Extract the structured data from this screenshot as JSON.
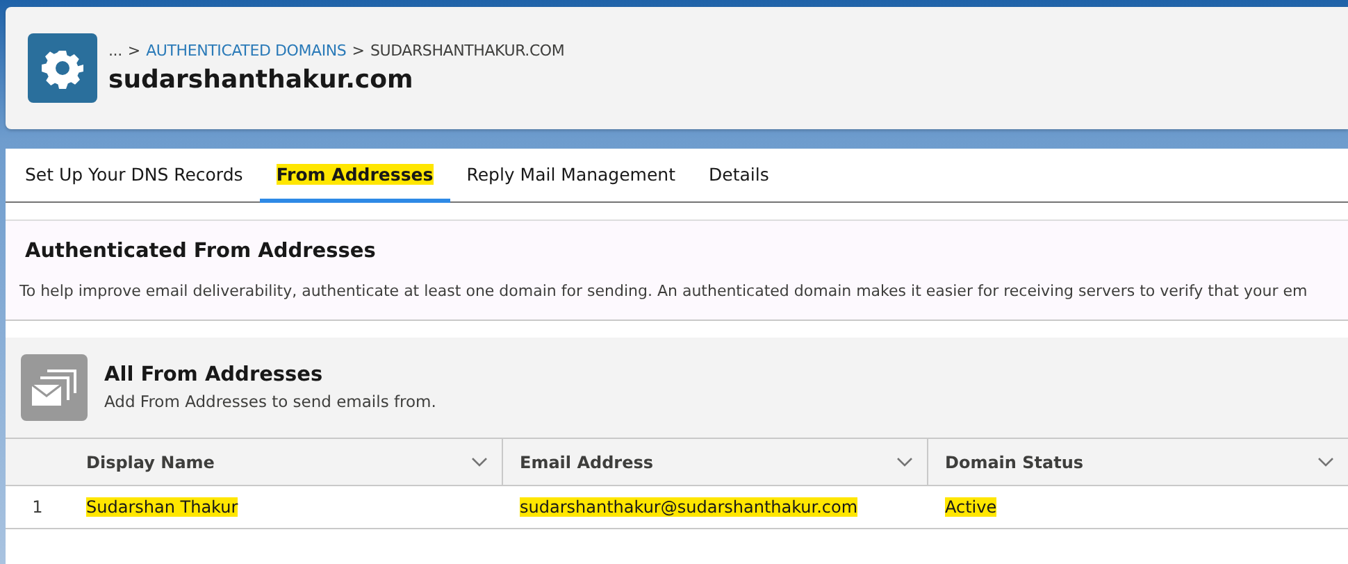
{
  "header": {
    "breadcrumbs": [
      {
        "label": "...",
        "kind": "ellipsis"
      },
      {
        "label": "AUTHENTICATED DOMAINS",
        "kind": "link"
      },
      {
        "label": "SUDARSHANTHAKUR.COM",
        "kind": "current"
      }
    ],
    "separator": ">",
    "title": "sudarshanthakur.com"
  },
  "tabs": [
    {
      "label": "Set Up Your DNS Records",
      "selected": false,
      "highlighted": false
    },
    {
      "label": "From Addresses",
      "selected": true,
      "highlighted": true
    },
    {
      "label": "Reply Mail Management",
      "selected": false,
      "highlighted": false
    },
    {
      "label": "Details",
      "selected": false,
      "highlighted": false
    }
  ],
  "notice": {
    "title": "Authenticated From Addresses",
    "text": "To help improve email deliverability, authenticate at least one domain for sending. An authenticated domain makes it easier for receiving servers to verify that your em"
  },
  "list": {
    "title": "All From Addresses",
    "subtitle": "Add From Addresses to send emails from."
  },
  "table": {
    "columns": [
      "Display Name",
      "Email Address",
      "Domain Status"
    ],
    "rows": [
      {
        "number": "1",
        "cells": [
          {
            "text": "Sudarshan Thakur",
            "highlighted": true
          },
          {
            "text": "sudarshanthakur@sudarshanthakur.com",
            "highlighted": true
          },
          {
            "text": "Active",
            "highlighted": true
          }
        ]
      }
    ]
  }
}
